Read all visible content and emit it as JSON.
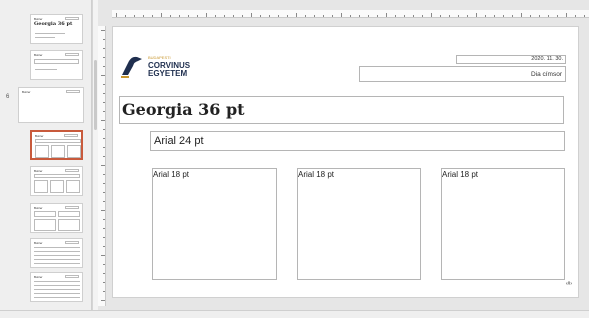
{
  "thumbnails": [
    {
      "number": "",
      "label": "Bolzer",
      "title": "Georgia 36 pt",
      "kind": "title"
    },
    {
      "number": "",
      "label": "Bolzer",
      "title": "",
      "kind": "two-lines"
    },
    {
      "number": "6",
      "label": "Bolzer",
      "title": "",
      "kind": "blank"
    },
    {
      "number": "",
      "label": "Bolzer",
      "title": "",
      "kind": "three-box",
      "selected": true
    },
    {
      "number": "",
      "label": "Bolzer",
      "title": "",
      "kind": "three-box-small"
    },
    {
      "number": "",
      "label": "Bolzer",
      "title": "",
      "kind": "two-col"
    },
    {
      "number": "",
      "label": "Bolzer",
      "title": "",
      "kind": "table"
    },
    {
      "number": "",
      "label": "Bolzer",
      "title": "",
      "kind": "table2"
    }
  ],
  "slide": {
    "logo": {
      "line1": "BUDAPESTI",
      "line2": "CORVINUS",
      "line3": "EGYETEM",
      "accent_color": "#c8972f",
      "brand_color": "#1f2f4f"
    },
    "date": "2020. 11. 30.",
    "subtitle_right": "Dia címsor",
    "title": "Georgia 36 pt",
    "subtitle": "Arial 24 pt",
    "columns": [
      {
        "text": "Arial 18 pt"
      },
      {
        "text": "Arial 18 pt"
      },
      {
        "text": "Arial 18 pt"
      }
    ],
    "page_number": "‹#›"
  },
  "colors": {
    "selection_border": "#c85a3c",
    "placeholder_border": "#b5b5b5",
    "title_text": "#222222"
  }
}
